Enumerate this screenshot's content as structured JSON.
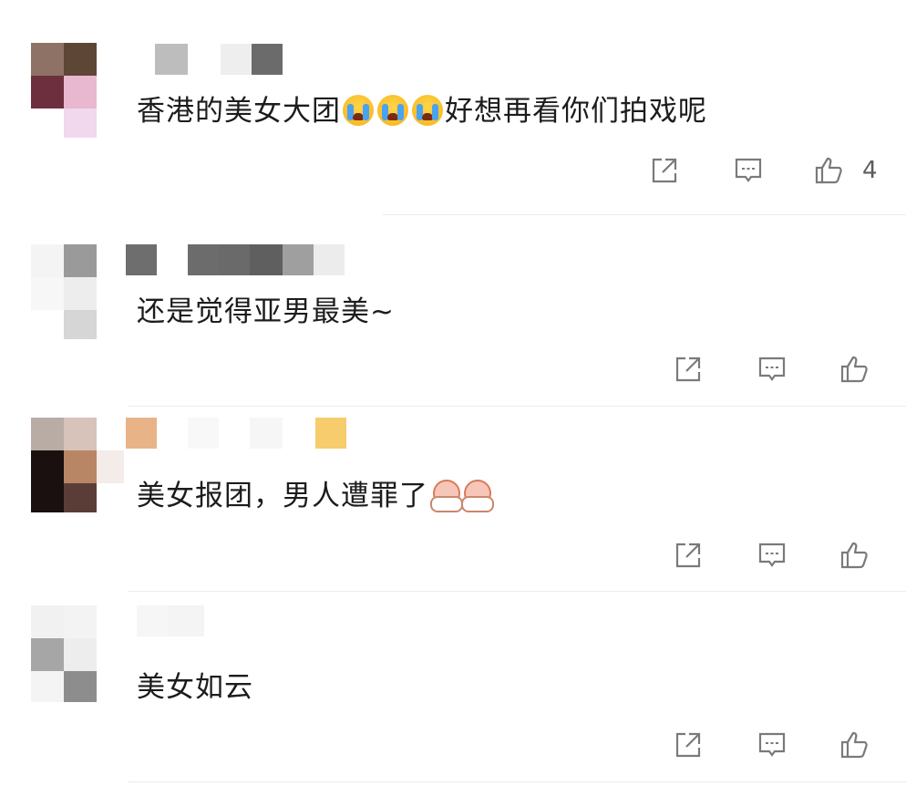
{
  "comments": [
    {
      "text_before": "香港的美女大团",
      "text_after": "好想再看你们拍戏呢",
      "emoji": "loudly-crying-face x3",
      "like_count": "4"
    },
    {
      "text": "还是觉得亚男最美~"
    },
    {
      "text": "美女报团，男人遭罪了",
      "emoji": "shy-face x2"
    },
    {
      "text": "美女如云"
    }
  ],
  "colors": {
    "icon_stroke": "#7a7a7a",
    "divider": "#ececec",
    "text": "#1c1c1c"
  },
  "icons": [
    "share-icon",
    "comment-icon",
    "like-icon"
  ]
}
